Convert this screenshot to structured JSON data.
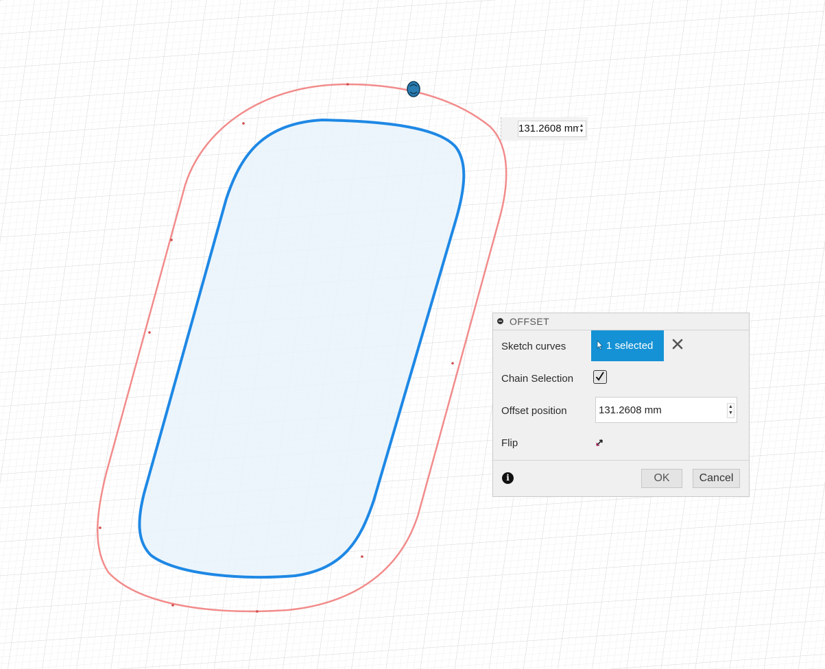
{
  "canvas": {
    "onscreen_value": "131.2608 mm",
    "colors": {
      "grid_minor": "#eeeeee",
      "grid_major": "#dcdcdc",
      "offset_curve": "#f28b8b",
      "profile_curve": "#1e88e5",
      "profile_fill": "#e9f3fa",
      "handle": "#2b7cb0"
    }
  },
  "dialog": {
    "title": "OFFSET",
    "rows": {
      "sketch_curves_label": "Sketch curves",
      "selection_text": "1 selected",
      "chain_selection_label": "Chain Selection",
      "chain_selection_checked": true,
      "offset_position_label": "Offset position",
      "offset_position_value": "131.2608 mm",
      "flip_label": "Flip"
    },
    "buttons": {
      "ok_label": "OK",
      "cancel_label": "Cancel"
    },
    "icons": {
      "collapse": "collapse-icon",
      "cursor": "cursor-arrow-icon",
      "clear": "close-icon",
      "check": "checkmark-icon",
      "flip": "flip-arrows-icon",
      "info": "info-icon"
    }
  }
}
